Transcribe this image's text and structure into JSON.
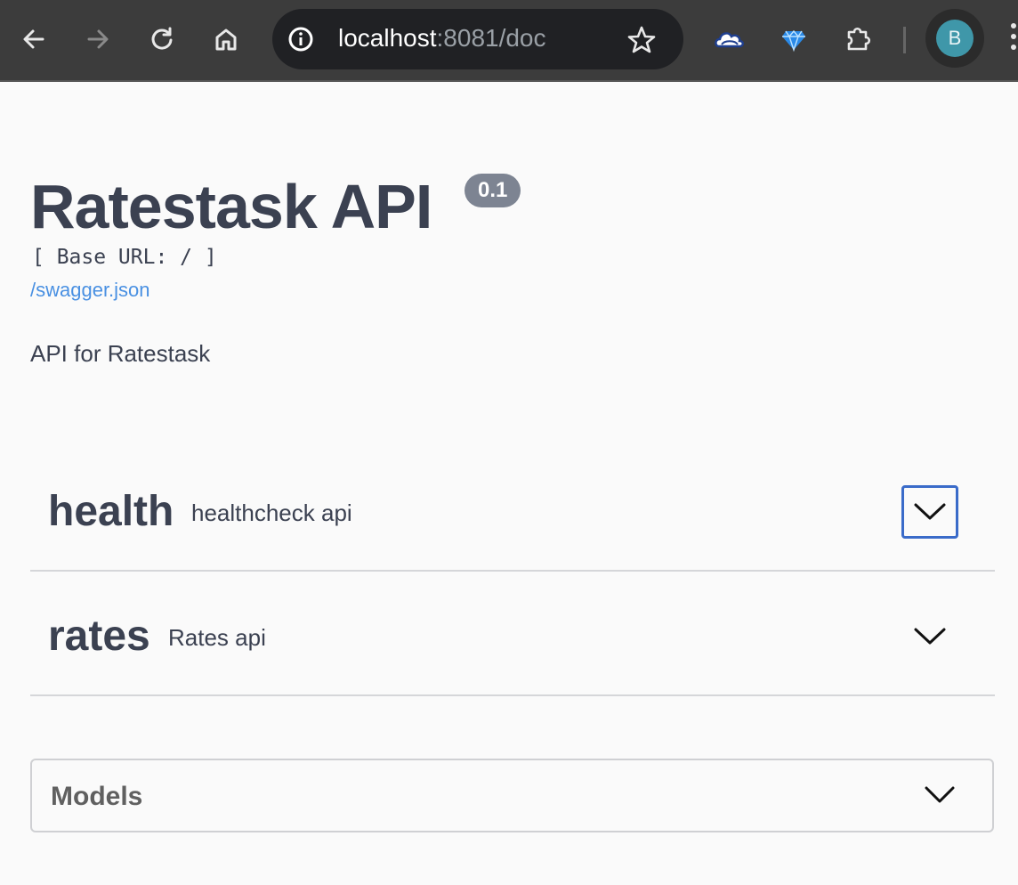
{
  "browser": {
    "url_host": "localhost",
    "url_rest": ":8081/doc",
    "profile_initial": "B"
  },
  "info": {
    "title": "Ratestask API",
    "version": "0.1",
    "base_url": "[ Base URL: / ]",
    "spec_link": "/swagger.json",
    "description": "API for Ratestask"
  },
  "tags": [
    {
      "name": "health",
      "description": "healthcheck api"
    },
    {
      "name": "rates",
      "description": "Rates api"
    }
  ],
  "models": {
    "title": "Models"
  }
}
